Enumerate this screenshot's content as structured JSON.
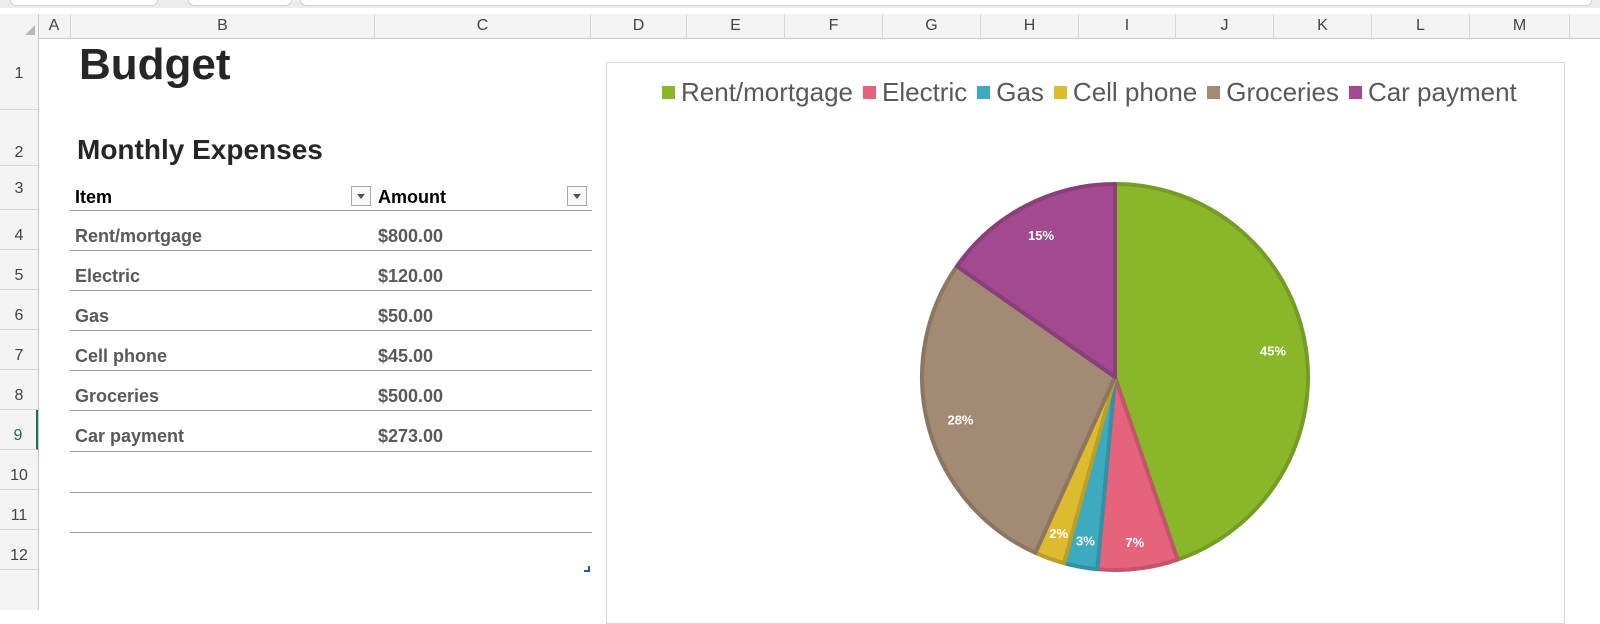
{
  "sheet": {
    "columns": [
      "A",
      "B",
      "C",
      "D",
      "E",
      "F",
      "G",
      "H",
      "I",
      "J",
      "K",
      "L",
      "M"
    ],
    "rows": [
      "1",
      "2",
      "3",
      "4",
      "5",
      "6",
      "7",
      "8",
      "9",
      "10",
      "11",
      "12"
    ],
    "active_row": "9"
  },
  "title": "Budget",
  "subtitle": "Monthly Expenses",
  "table": {
    "headers": {
      "item": "Item",
      "amount": "Amount"
    },
    "rows": [
      {
        "item": "Rent/mortgage",
        "amount": "$800.00"
      },
      {
        "item": "Electric",
        "amount": "$120.00"
      },
      {
        "item": "Gas",
        "amount": "$50.00"
      },
      {
        "item": "Cell phone",
        "amount": "$45.00"
      },
      {
        "item": "Groceries",
        "amount": "$500.00"
      },
      {
        "item": "Car payment",
        "amount": "$273.00"
      }
    ]
  },
  "chart_data": {
    "type": "pie",
    "categories": [
      "Rent/mortgage",
      "Electric",
      "Gas",
      "Cell phone",
      "Groceries",
      "Car payment"
    ],
    "values": [
      800,
      120,
      50,
      45,
      500,
      273
    ],
    "data_labels": [
      "45%",
      "7%",
      "3%",
      "2%",
      "28%",
      "15%"
    ],
    "colors": [
      "#8ab72a",
      "#e6637e",
      "#3caabf",
      "#dcbb2f",
      "#a38a75",
      "#a2498f"
    ],
    "legend_position": "top"
  }
}
